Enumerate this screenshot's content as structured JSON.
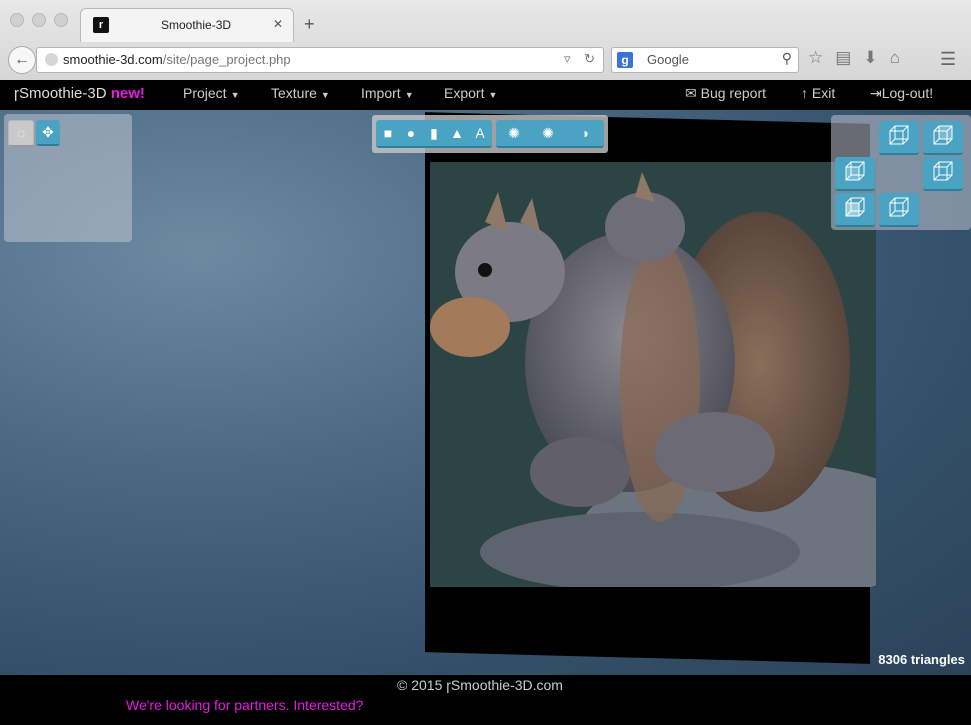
{
  "browser": {
    "tab_title": "Smoothie-3D",
    "url_host": "smoothie-3d.com",
    "url_path": "/site/page_project.php",
    "search_placeholder": "Google"
  },
  "app": {
    "brand": "Smoothie-3D",
    "brand_new": "new!",
    "menus": [
      "Project",
      "Texture",
      "Import",
      "Export"
    ],
    "bug_report": "Bug report",
    "exit": "Exit",
    "logout": "Log-out!"
  },
  "toolbar": {
    "text_tool_label": "A"
  },
  "viewport": {
    "triangles": "8306 triangles"
  },
  "footer": {
    "copyright": "© 2015",
    "site": "Smoothie-3D.com",
    "partners": "We're looking for partners. Interested?"
  },
  "colors": {
    "accent": "#4aa3c2",
    "brand_new": "#e619e6",
    "appbar": "#000000"
  }
}
